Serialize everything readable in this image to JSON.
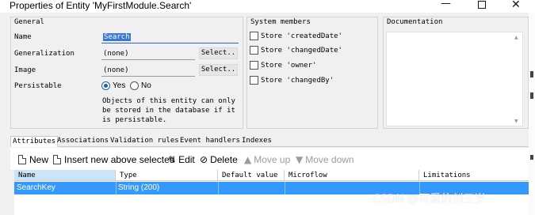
{
  "window": {
    "title": "Properties of Entity 'MyFirstModule.Search'"
  },
  "general": {
    "title": "General",
    "name_label": "Name",
    "name_value": "Search",
    "generalization_label": "Generalization",
    "generalization_value": "(none)",
    "image_label": "Image",
    "image_value": "(none)",
    "select_label": "Select..",
    "persistable_label": "Persistable",
    "persistable_yes": "Yes",
    "persistable_no": "No",
    "persistable_selected": "Yes",
    "note_lines": [
      "Objects of this entity can only",
      "be stored in the database if it",
      "is persistable."
    ]
  },
  "system_members": {
    "title": "System members",
    "items": [
      {
        "label": "Store 'createdDate'",
        "checked": false
      },
      {
        "label": "Store 'changedDate'",
        "checked": false
      },
      {
        "label": "Store 'owner'",
        "checked": false
      },
      {
        "label": "Store 'changedBy'",
        "checked": false
      }
    ]
  },
  "documentation": {
    "title": "Documentation"
  },
  "tabs": [
    {
      "label": "Attributes",
      "active": true
    },
    {
      "label": "Associations",
      "active": false
    },
    {
      "label": "Validation rules",
      "active": false
    },
    {
      "label": "Event handlers",
      "active": false
    },
    {
      "label": "Indexes",
      "active": false
    }
  ],
  "toolbar": {
    "new": "New",
    "insert_new_above": "Insert new above selected",
    "edit": "Edit",
    "delete": "Delete",
    "move_up": "Move up",
    "move_down": "Move down",
    "icons": {
      "new": "new-document-icon",
      "insert": "insert-document-icon",
      "edit": "pencil-icon",
      "delete": "delete-icon",
      "move_up": "arrow-up-icon",
      "move_down": "arrow-down-icon"
    }
  },
  "grid": {
    "columns": [
      "Name",
      "Type",
      "Default value",
      "Microflow",
      "Limitations"
    ],
    "rows": [
      {
        "name": "SearchKey",
        "type": "String (200)",
        "default_value": "",
        "microflow": "",
        "limitations": ""
      }
    ]
  },
  "watermark": "CSDN @可爱的刘三岁",
  "colors": {
    "selection": "#3399ff",
    "header_active": "#cce4f7",
    "radio_accent": "#1a5fb4"
  }
}
